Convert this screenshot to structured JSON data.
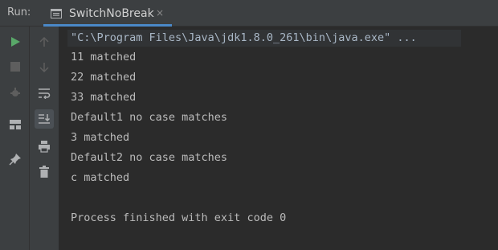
{
  "header": {
    "run_label": "Run:",
    "tab": {
      "title": "SwitchNoBreak",
      "close": "×"
    }
  },
  "left_toolbar": [
    {
      "icon": "run-icon",
      "color": "#59a869"
    },
    {
      "icon": "stop-icon",
      "color": "#6a6a6a"
    },
    {
      "icon": "rerun-failed-icon",
      "color": "#6a6a6a"
    },
    {
      "icon": "layout-icon",
      "color": "#afb1b3"
    },
    {
      "icon": "pin-icon",
      "color": "#afb1b3"
    }
  ],
  "second_toolbar": [
    {
      "icon": "arrow-up-icon"
    },
    {
      "icon": "arrow-down-icon"
    },
    {
      "icon": "soft-wrap-icon"
    },
    {
      "icon": "scroll-to-end-icon",
      "active": true
    },
    {
      "icon": "print-icon"
    },
    {
      "icon": "trash-icon"
    }
  ],
  "console": {
    "command": "\"C:\\Program Files\\Java\\jdk1.8.0_261\\bin\\java.exe\" ...",
    "lines": [
      "11 matched",
      "22 matched",
      "33 matched",
      "Default1 no case matches",
      "3 matched",
      "Default2 no case matches",
      "c matched",
      "",
      "Process finished with exit code 0"
    ]
  }
}
